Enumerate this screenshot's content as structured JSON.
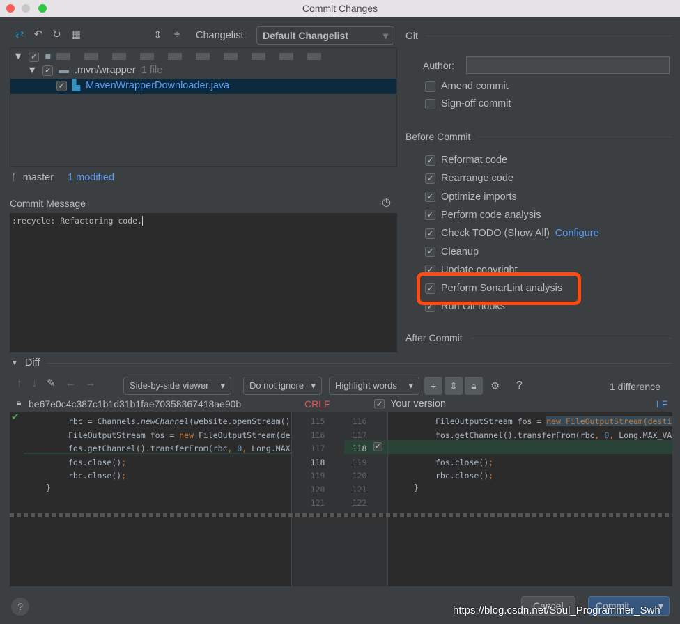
{
  "window": {
    "title": "Commit Changes"
  },
  "toolbar": {
    "changelist_label": "Changelist:",
    "changelist_value": "Default Changelist"
  },
  "tree": {
    "folder": ".mvn/wrapper",
    "folder_count": "1 file",
    "file": "MavenWrapperDownloader.java"
  },
  "status": {
    "branch": "master",
    "modified": "1 modified"
  },
  "commit_message": {
    "label": "Commit Message",
    "value": ":recycle: Refactoring code."
  },
  "git": {
    "header": "Git",
    "author_label": "Author:",
    "author_value": "",
    "amend": "Amend commit",
    "signoff": "Sign-off commit"
  },
  "before_commit": {
    "header": "Before Commit",
    "items": [
      {
        "label": "Reformat code",
        "checked": true
      },
      {
        "label": "Rearrange code",
        "checked": true
      },
      {
        "label": "Optimize imports",
        "checked": true
      },
      {
        "label": "Perform code analysis",
        "checked": true
      },
      {
        "label": "Check TODO (Show All)",
        "checked": true,
        "link": "Configure"
      },
      {
        "label": "Cleanup",
        "checked": true
      },
      {
        "label": "Update copyright",
        "checked": true
      },
      {
        "label": "Perform SonarLint analysis",
        "checked": true
      },
      {
        "label": "Run Git hooks",
        "checked": true
      }
    ],
    "highlight_color": "#ff4a12"
  },
  "after_commit": {
    "header": "After Commit"
  },
  "diff": {
    "header": "Diff",
    "viewer": "Side-by-side viewer",
    "ignore": "Do not ignore",
    "highlight": "Highlight words",
    "differences": "1 difference",
    "help": "?",
    "left_title": "be67e0c4c387c1b1d31b1fae70358367418ae90b",
    "left_eol": "CRLF",
    "right_title": "Your version",
    "right_eol": "LF",
    "left_lines": [
      "115",
      "116",
      "117",
      "118",
      "119",
      "120",
      "121"
    ],
    "right_lines": [
      "116",
      "117",
      "118",
      "119",
      "120",
      "121",
      "122"
    ]
  },
  "footer": {
    "cancel": "Cancel",
    "commit": "Commit",
    "help": "?",
    "watermark": "https://blog.csdn.net/Soul_Programmer_Swh"
  }
}
